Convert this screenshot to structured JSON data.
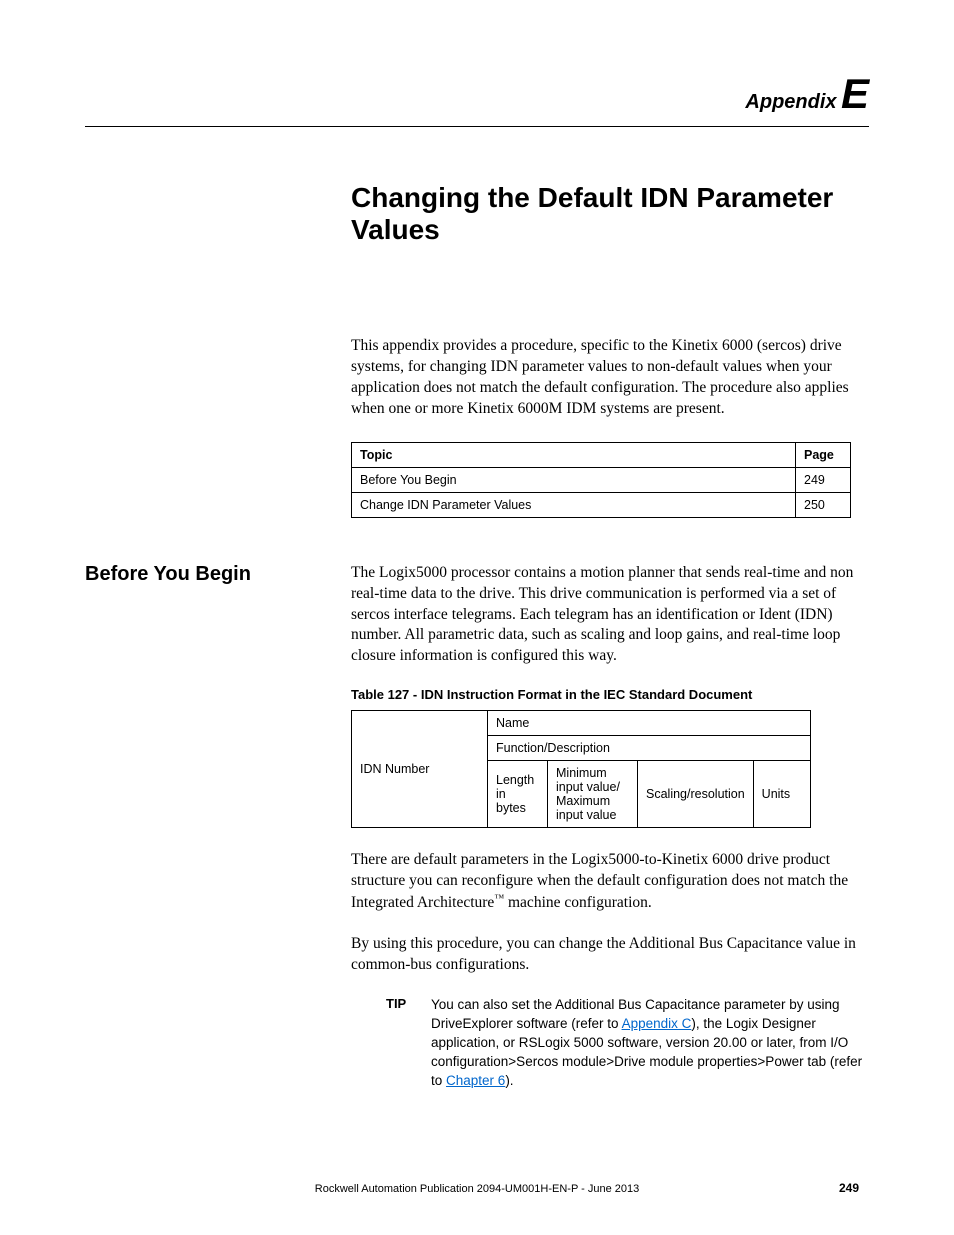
{
  "header": {
    "word": "Appendix",
    "letter": "E"
  },
  "chapter_title": "Changing the Default IDN Parameter Values",
  "intro": "This appendix provides a procedure, specific to the Kinetix 6000 (sercos) drive systems, for changing IDN parameter values to non-default values when your application does not match the default configuration. The procedure also applies when one or more Kinetix 6000M IDM systems are present.",
  "topic_table": {
    "head": {
      "topic": "Topic",
      "page": "Page"
    },
    "rows": [
      {
        "topic": "Before You Begin",
        "page": "249"
      },
      {
        "topic": "Change IDN Parameter Values",
        "page": "250"
      }
    ]
  },
  "section_heading": "Before You Begin",
  "para1": "The Logix5000 processor contains a motion planner that sends real-time and non real-time data to the drive. This drive communication is performed via a set of sercos interface telegrams. Each telegram has an identification or Ident (IDN) number. All parametric data, such as scaling and loop gains, and real-time loop closure information is configured this way.",
  "table_caption": "Table 127 - IDN Instruction Format in the IEC Standard Document",
  "format_table": {
    "idn": "IDN Number",
    "name": "Name",
    "func": "Function/Description",
    "length": "Length in bytes",
    "minmax": "Minimum input value/ Maximum input value",
    "scaling": "Scaling/resolution",
    "units": "Units"
  },
  "para2_a": "There are default parameters in the Logix5000-to-Kinetix 6000 drive product structure you can reconfigure when the default configuration does not match the Integrated Architecture",
  "para2_b": " machine configuration.",
  "para3": "By using this procedure, you can change the Additional Bus Capacitance value in common-bus configurations.",
  "tip": {
    "label": "TIP",
    "t1": "You can also set the Additional Bus Capacitance parameter by using DriveExplorer software (refer to ",
    "link1": "Appendix C",
    "t2": "), the Logix Designer application, or RSLogix 5000 software, version 20.00 or later, from I/O configuration>Sercos module>Drive module properties>Power tab (refer to ",
    "link2": "Chapter 6",
    "t3": ")."
  },
  "footer": {
    "pub": "Rockwell Automation Publication 2094-UM001H-EN-P - June 2013",
    "page": "249"
  }
}
